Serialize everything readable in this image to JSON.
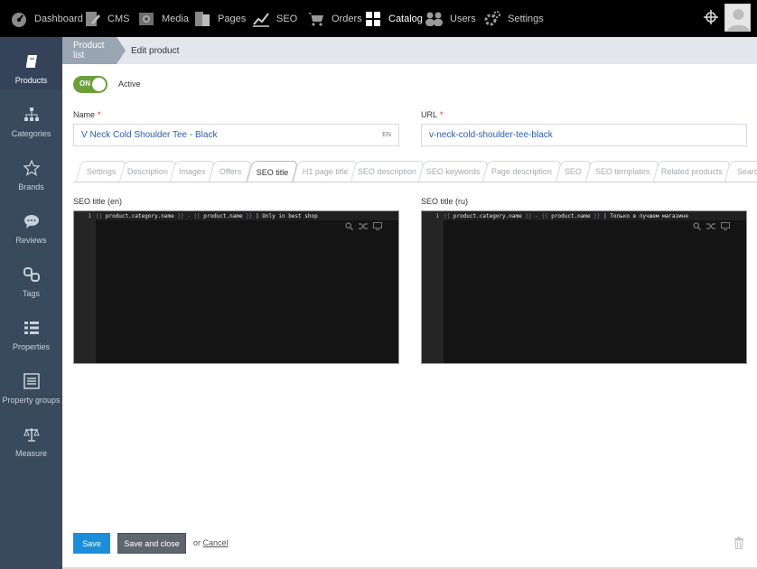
{
  "topnav": [
    {
      "label": "Dashboard",
      "icon": "dashboard-icon"
    },
    {
      "label": "CMS",
      "icon": "cms-icon"
    },
    {
      "label": "Media",
      "icon": "media-icon"
    },
    {
      "label": "Pages",
      "icon": "pages-icon"
    },
    {
      "label": "SEO",
      "icon": "seo-chart-icon"
    },
    {
      "label": "Orders",
      "icon": "cart-icon"
    },
    {
      "label": "Catalog",
      "icon": "catalog-grid-icon",
      "active": true
    },
    {
      "label": "Users",
      "icon": "users-icon"
    },
    {
      "label": "Settings",
      "icon": "gears-icon"
    }
  ],
  "sidebar": [
    {
      "label": "Products",
      "icon": "book-icon",
      "active": true
    },
    {
      "label": "Categories",
      "icon": "sitemap-icon"
    },
    {
      "label": "Brands",
      "icon": "star-icon"
    },
    {
      "label": "Reviews",
      "icon": "comment-icon"
    },
    {
      "label": "Tags",
      "icon": "link-icon"
    },
    {
      "label": "Properties",
      "icon": "list-icon"
    },
    {
      "label": "Property groups",
      "icon": "list-box-icon"
    },
    {
      "label": "Measure",
      "icon": "scales-icon"
    }
  ],
  "breadcrumb": {
    "first": "Product list",
    "second": "Edit product"
  },
  "toggle": {
    "state": "ON",
    "label": "Active"
  },
  "name_field": {
    "label": "Name",
    "value": "V Neck Cold Shoulder Tee - Black",
    "lang": "EN"
  },
  "url_field": {
    "label": "URL",
    "value": "v-neck-cold-shoulder-tee-black"
  },
  "tabs": [
    "Settings",
    "Description",
    "Images",
    "Offers",
    "SEO title",
    "H1 page title",
    "SEO description",
    "SEO keywords",
    "Page description",
    "SEO",
    "SEO templates",
    "Related products",
    "Search"
  ],
  "active_tab": "SEO title",
  "editors": [
    {
      "label": "SEO title (en)",
      "line": "1",
      "code": {
        "open1": "{{",
        "var1": " product.category.name ",
        "close1": "}}",
        "dash": " - ",
        "open2": "{{",
        "var2": " product.name ",
        "close2": "}}",
        "tail": " | Only in best shop"
      }
    },
    {
      "label": "SEO title (ru)",
      "line": "1",
      "code": {
        "open1": "{{",
        "var1": " product.category.name ",
        "close1": "}}",
        "dash": " - ",
        "open2": "{{",
        "var2": " product.name ",
        "close2": "}}",
        "tail": " | Только в лучшем магазине"
      }
    }
  ],
  "buttons": {
    "save": "Save",
    "save_close": "Save and close",
    "or": "or",
    "cancel": "Cancel"
  },
  "colors": {
    "accent": "#1c8dd8",
    "toggle_on": "#6a9f3a",
    "sidebar": "#3a4a5d",
    "required": "#d9232d"
  }
}
